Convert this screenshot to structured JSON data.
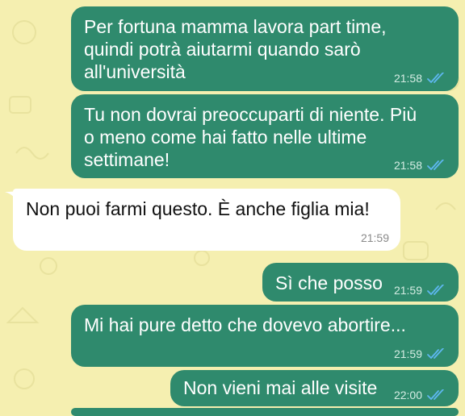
{
  "colors": {
    "outgoing_bubble": "#2f8a6d",
    "incoming_bubble": "#ffffff",
    "wallpaper": "#f5efb0",
    "read_ticks": "#5eb7f0"
  },
  "messages": [
    {
      "direction": "out",
      "text": "Per fortuna mamma lavora part time,\nquindi potrà aiutarmi quando sarò\nall'università",
      "time": "21:58",
      "status_icon": "double-check-read-icon"
    },
    {
      "direction": "out",
      "text": "Tu non dovrai preoccuparti di niente. Più\no meno come hai fatto nelle ultime\nsettimane!",
      "time": "21:58",
      "status_icon": "double-check-read-icon"
    },
    {
      "direction": "in",
      "text": "Non puoi farmi questo. È anche figlia mia!",
      "time": "21:59"
    },
    {
      "direction": "out",
      "text": "Sì che posso",
      "time": "21:59",
      "status_icon": "double-check-read-icon"
    },
    {
      "direction": "out",
      "text": "Mi hai pure detto che dovevo abortire...",
      "time": "21:59",
      "status_icon": "double-check-read-icon"
    },
    {
      "direction": "out",
      "text": "Non vieni mai alle visite",
      "time": "22:00",
      "status_icon": "double-check-read-icon"
    }
  ]
}
